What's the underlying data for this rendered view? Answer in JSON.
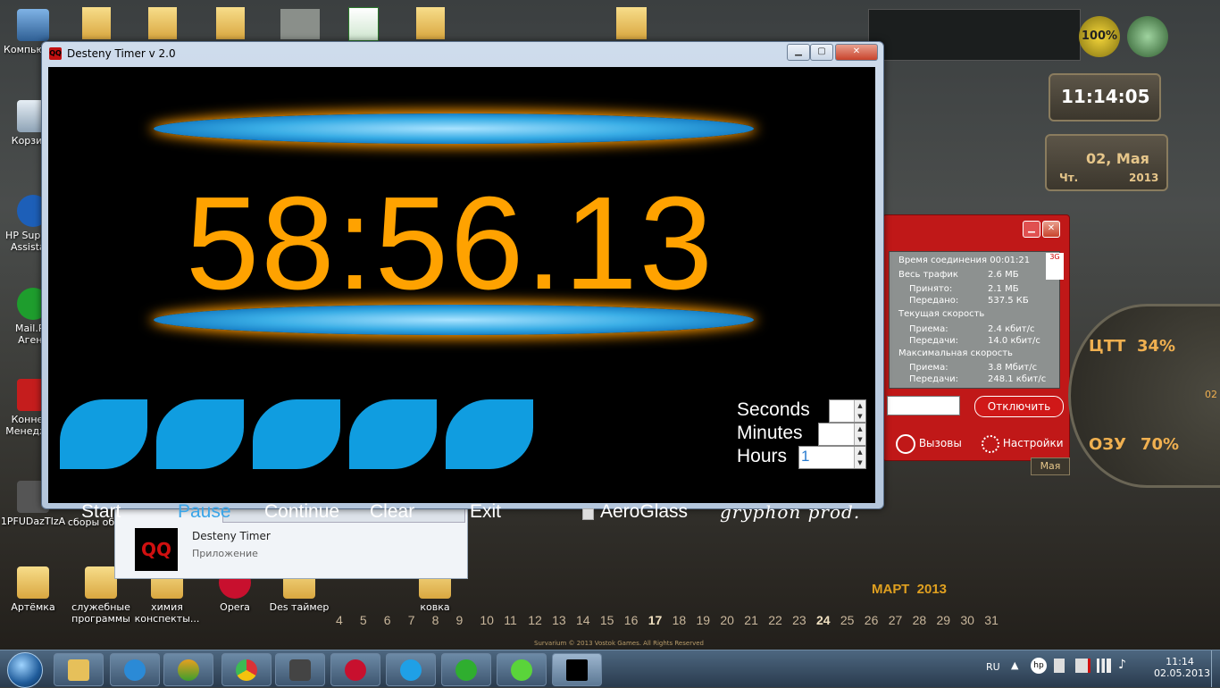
{
  "desktop": {
    "icons_left": [
      "Компьютер",
      "Корзина",
      "HP Support Assistant",
      "Mail.Ru Агент",
      "Коннект Менеджер",
      "1PFUDazTIzA"
    ],
    "icons_bottom": [
      "Артёмка",
      "служебные программы",
      "химия конспекты...",
      "Opera",
      "Des таймер",
      "ковка"
    ],
    "icons_mid": [
      "сборы обж"
    ]
  },
  "window": {
    "title": "Desteny Timer v 2.0",
    "app_icon": "QQ",
    "minimize": "▁",
    "maximize": "▢",
    "close": "✕"
  },
  "timer": {
    "display": "58:56.13",
    "buttons": [
      "Start",
      "Pause",
      "Continue",
      "Clear",
      "Exit"
    ],
    "active_button": "Pause"
  },
  "controls": {
    "seconds_label": "Seconds",
    "minutes_label": "Minutes",
    "hours_label": "Hours",
    "seconds_value": "",
    "minutes_value": "",
    "hours_value": "1",
    "aeroglass_label": "AeroGlass",
    "aeroglass_checked": false,
    "signature": "gryphon prod."
  },
  "popup": {
    "name": "Desteny Timer",
    "subtitle": "Приложение"
  },
  "connection": {
    "time_label": "Время соединения",
    "time_value": "00:01:21",
    "traffic_label": "Весь трафик",
    "traffic_value": "2.6 МБ",
    "received_label": "Принято:",
    "received_value": "2.1 МБ",
    "sent_label": "Передано:",
    "sent_value": "537.5 КБ",
    "current_label": "Текущая скорость",
    "cur_rx_label": "Приема:",
    "cur_rx_value": "2.4 кбит/с",
    "cur_tx_label": "Передачи:",
    "cur_tx_value": "14.0 кбит/с",
    "max_label": "Максимальная скорость",
    "max_rx_label": "Приема:",
    "max_rx_value": "3.8 Мбит/с",
    "max_tx_label": "Передачи:",
    "max_tx_value": "248.1 кбит/с",
    "badge": "3G",
    "disconnect": "Отключить",
    "calls": "Вызовы",
    "settings": "Настройки"
  },
  "widgets": {
    "battery": "100%",
    "clock": "11:14:05",
    "date": "02, Мая",
    "weekday": "Чт.",
    "year": "2013",
    "cpu_label": "ЦТТ",
    "cpu_value": "34%",
    "ram_label": "ОЗУ",
    "ram_value": "70%",
    "month_tag": "Мая",
    "side_num": "02"
  },
  "calendar": {
    "header": "МАРТ  2013",
    "days": [
      "4",
      "5",
      "6",
      "7",
      "8",
      "9",
      "10",
      "11",
      "12",
      "13",
      "14",
      "15",
      "16",
      "17",
      "18",
      "19",
      "20",
      "21",
      "22",
      "23",
      "24",
      "25",
      "26",
      "27",
      "28",
      "29",
      "30",
      "31"
    ]
  },
  "taskbar": {
    "lang": "RU",
    "time": "11:14",
    "date": "02.05.2013",
    "footer": "Survarium © 2013 Vostok Games. All Rights Reserved"
  }
}
